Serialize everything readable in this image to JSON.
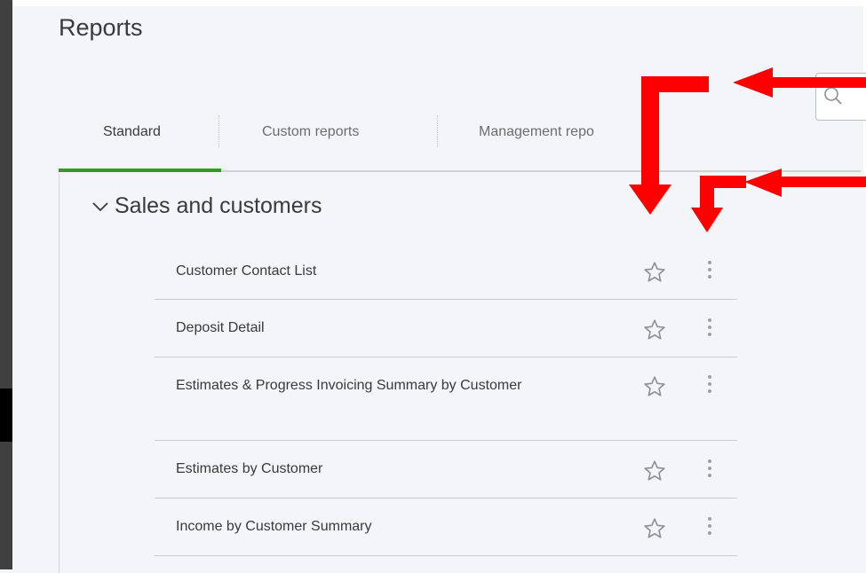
{
  "page": {
    "title": "Reports"
  },
  "search": {
    "icon": "search-icon"
  },
  "tabs": [
    {
      "label": "Standard",
      "active": true
    },
    {
      "label": "Custom reports",
      "active": false
    },
    {
      "label": "Management repo",
      "active": false
    }
  ],
  "section": {
    "title": "Sales and customers",
    "expanded": true
  },
  "reports": [
    {
      "name": "Customer Contact List",
      "favorite": false
    },
    {
      "name": "Deposit Detail",
      "favorite": false
    },
    {
      "name": "Estimates & Progress Invoicing Summary by Customer",
      "favorite": false
    },
    {
      "name": "Estimates by Customer",
      "favorite": false
    },
    {
      "name": "Income by Customer Summary",
      "favorite": false
    }
  ],
  "colors": {
    "accent_green": "#2ca01c",
    "annotation_red": "#ff0000",
    "text": "#393a3d"
  }
}
